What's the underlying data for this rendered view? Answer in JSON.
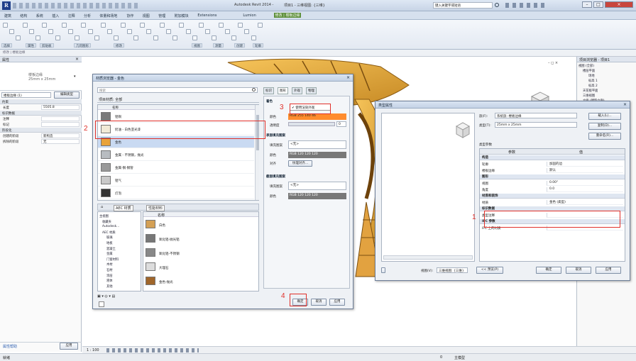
{
  "app": {
    "title": "Autodesk Revit 2014 -",
    "doc_title": "项目1 - 三维视图: {三维}",
    "search_placeholder": "键入关键字或短语"
  },
  "ribbon_tabs": [
    "建筑",
    "结构",
    "系统",
    "插入",
    "注释",
    "分析",
    "体量和场地",
    "协作",
    "视图",
    "管理",
    "附加模块",
    "Extensions",
    "Lumion",
    "修改 | 楼板边缘"
  ],
  "ribbon_groups": [
    "选择",
    "属性",
    "剪贴板",
    "几何图形",
    "修改",
    "视图",
    "测量",
    "创建",
    "轮廓"
  ],
  "left": {
    "header": "属性",
    "type_name": "楼板边缘",
    "type_sub": "25mm x 25mm",
    "selector": "楼板边缘 (1)",
    "edit_type": "编辑类型",
    "sections": [
      "约束",
      "尺寸标注",
      "标识数据",
      "阶段化"
    ],
    "rows": [
      {
        "k": "长度",
        "v": "5505.8"
      },
      {
        "k": "注释",
        "v": ""
      },
      {
        "k": "标记",
        "v": ""
      },
      {
        "k": "创建的阶段",
        "v": "新构造"
      },
      {
        "k": "拆除的阶段",
        "v": "无"
      }
    ],
    "help": "属性帮助",
    "apply": "应用"
  },
  "material_browser": {
    "title": "材质浏览器 - 金色",
    "search": "搜索",
    "filter": "项目材质: 全部",
    "header": "名称",
    "items": [
      "铝铜",
      "奶油 - 白色亚光漆",
      "金色",
      "金属 - 不锈钢，抛光",
      "金属-钢-钢管",
      "铝气",
      "灯泡"
    ],
    "lib_tabs": [
      "AEC 材质",
      "性能材料"
    ],
    "lib_tree": [
      "主视图",
      "收藏夹",
      "Autodesk...",
      "AEC 材质",
      "玻璃",
      "地板",
      "混凝土",
      "金属",
      "门窗材料",
      "木材",
      "石材",
      "涂层",
      "液体",
      "其他"
    ],
    "lib_items": [
      "白色",
      "氧化铝-抛光铝",
      "氧化铝-不锈钢",
      "大理石",
      "金色-抛光"
    ],
    "asset_tabs": [
      "标识",
      "图形",
      "外观",
      "物理"
    ],
    "use_render": "使用渲染外观",
    "color_label": "颜色",
    "color_value": "RGB 255 140 46",
    "transparency_label": "透明度",
    "transparency_value": "0",
    "sections": [
      "着色",
      "表面填充图案",
      "截面填充图案"
    ],
    "fill_label": "填充图案",
    "fill_value": "<无>",
    "color2_value": "RGB 120 120 120",
    "align_label": "对齐",
    "align_btn": "纹理对齐...",
    "fill2_value": "<无>",
    "color3_value": "RGB 120 120 120",
    "ok": "确定",
    "cancel": "取消",
    "apply": "应用",
    "colors": {
      "gold": "#e8a33a",
      "selection": "#c9daf2",
      "highlight": "#ff8c2e"
    }
  },
  "type_props": {
    "title": "类型属性",
    "family_label": "族(F):",
    "family_value": "系统族: 楼板边缘",
    "type_label": "类型(T):",
    "type_value": "25mm x 25mm",
    "load": "载入(L)...",
    "duplicate": "复制(D)...",
    "rename": "重命名(R)...",
    "params_label": "类型参数",
    "col_param": "参数",
    "col_value": "值",
    "sections": [
      "构造",
      "图形",
      "材质和装饰",
      "标识数据",
      "IFC 参数"
    ],
    "rows": [
      {
        "k": "轮廓",
        "v": "加固的边"
      },
      {
        "k": "楼板边缘",
        "v": "默认"
      },
      {
        "k": "视图",
        "v": "0.00°"
      },
      {
        "k": "角度",
        "v": "0.0"
      },
      {
        "k": "材质",
        "v": "金色 (类型)"
      },
      {
        "k": "IFC 上的材质",
        "v": ""
      },
      {
        "k": "类型注释",
        "v": ""
      }
    ],
    "preview_btn": "<< 预览(P)",
    "ok": "确定",
    "cancel": "取消",
    "apply": "应用",
    "view_label": "视图(V):",
    "view_value": "三维视图: {三维}"
  },
  "browser": {
    "title": "项目浏览器 - 项目1",
    "items": [
      "视图 (全部)",
      "楼层平面",
      "场地",
      "标高 1",
      "标高 2",
      "天花板平面",
      "三维视图",
      "立面 (建筑立面)"
    ]
  },
  "status": {
    "left": "就绪",
    "scale": "1 : 100",
    "level": "0",
    "model": "主模型"
  },
  "annotations": [
    "1",
    "2",
    "3",
    "4"
  ]
}
